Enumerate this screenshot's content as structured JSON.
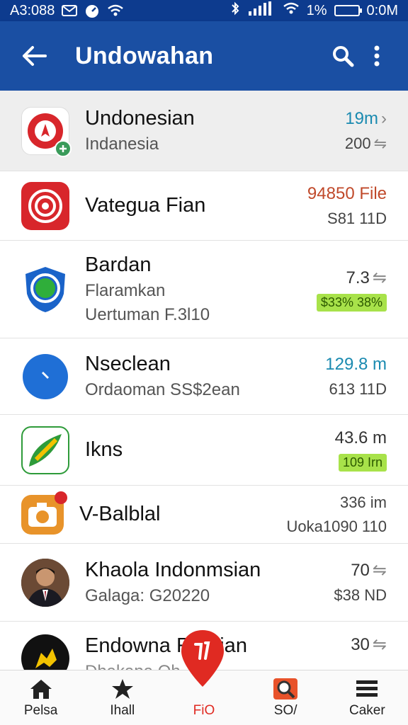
{
  "status_bar": {
    "left_text": "A3:088",
    "right_text": "1%",
    "time": "0:0M"
  },
  "app_bar": {
    "title": "Undowahan"
  },
  "rows": [
    {
      "name": "Undonesian",
      "sub": "Indanesia",
      "meta1": "19m",
      "meta2": "200",
      "icon": "red-leaf-icon",
      "color": "#d8262b",
      "selected": true
    },
    {
      "name": "Vategua Fian",
      "sub": "",
      "meta1": "94850 File",
      "meta2": "S81 11D",
      "icon": "target-icon",
      "color": "#d8262b"
    },
    {
      "name": "Bardan",
      "sub": "Flaramkan",
      "sub2": "Uertuman F.3l10",
      "meta1": "7.3",
      "meta2": "$33% 38%",
      "icon": "shield-icon",
      "color": "#1a63c9"
    },
    {
      "name": "Nseclean",
      "sub": "Ordaoman SS$2ean",
      "meta1": "129.8 m",
      "meta2": "613 11D",
      "icon": "messenger-icon",
      "color": "#1f6fd6"
    },
    {
      "name": "Ikns",
      "sub": "",
      "meta1": "43.6 m",
      "meta2": "109 Irn",
      "icon": "map-leaf-icon",
      "color": "#2e9b3a"
    },
    {
      "name": "V-Balblal",
      "sub": "",
      "meta1": "336 im",
      "meta2": "Uoka1090 110",
      "icon": "camera-icon",
      "color": "#e8932a"
    },
    {
      "name": "Khaola Indonmsian",
      "sub": "Galaga: G20220",
      "meta1": "70",
      "meta2": "$38 ND",
      "icon": "portrait-avatar",
      "color": "#5a3a2a"
    },
    {
      "name": "Endowna R   anian",
      "sub": "Dhakapa Oh",
      "meta1": "30",
      "meta2": "",
      "icon": "yellow-figure-icon",
      "color": "#111111"
    }
  ],
  "bottom_nav": [
    {
      "label": "Pelsa",
      "icon": "home-icon"
    },
    {
      "label": "Ihall",
      "icon": "star-icon"
    },
    {
      "label": "FiO",
      "icon": "pin-icon",
      "active": true
    },
    {
      "label": "SO/",
      "icon": "search-icon"
    },
    {
      "label": "Caker",
      "icon": "menu-icon"
    }
  ]
}
